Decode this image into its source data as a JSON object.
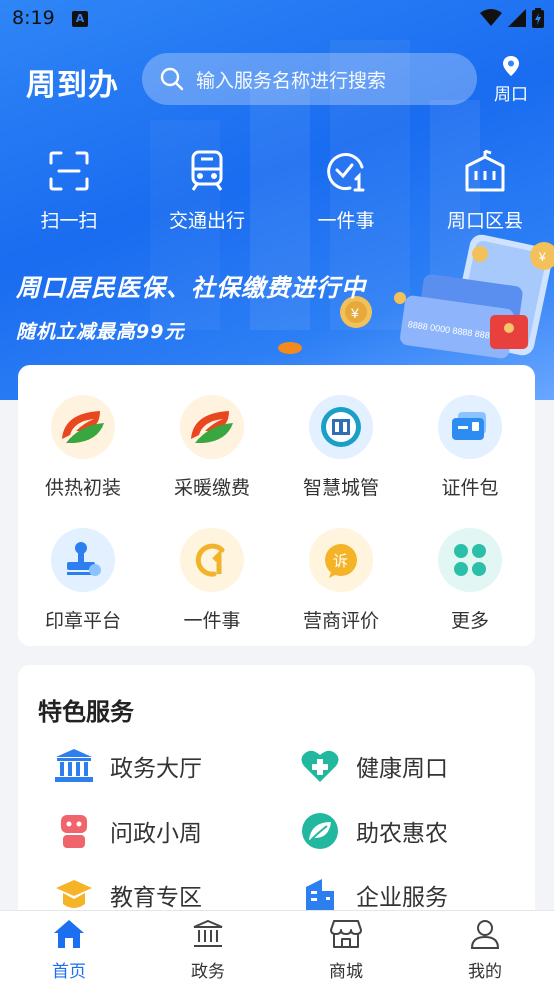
{
  "status_bar": {
    "time": "8:19"
  },
  "header": {
    "app_title": "周到办",
    "search_placeholder": "输入服务名称进行搜索",
    "location": "周口"
  },
  "quick_actions": [
    {
      "label": "扫一扫",
      "icon": "scan-icon"
    },
    {
      "label": "交通出行",
      "icon": "train-icon"
    },
    {
      "label": "一件事",
      "icon": "check-one-icon"
    },
    {
      "label": "周口区县",
      "icon": "building-icon"
    }
  ],
  "banner": {
    "title": "周口居民医保、社保缴费进行中",
    "subtitle": "随机立减最高99元",
    "card_number": "8888 0000 8888 888"
  },
  "service_grid": [
    {
      "label": "供热初装",
      "icon": "leaf-logo-icon"
    },
    {
      "label": "采暖缴费",
      "icon": "leaf-logo-icon"
    },
    {
      "label": "智慧城管",
      "icon": "city-badge-icon"
    },
    {
      "label": "证件包",
      "icon": "id-card-icon"
    },
    {
      "label": "印章平台",
      "icon": "stamp-icon"
    },
    {
      "label": "一件事",
      "icon": "one-thing-icon"
    },
    {
      "label": "营商评价",
      "icon": "complaint-icon"
    },
    {
      "label": "更多",
      "icon": "more-grid-icon"
    }
  ],
  "featured": {
    "title": "特色服务",
    "items": [
      {
        "label": "政务大厅",
        "icon": "hall-icon"
      },
      {
        "label": "健康周口",
        "icon": "health-icon"
      },
      {
        "label": "问政小周",
        "icon": "robot-icon"
      },
      {
        "label": "助农惠农",
        "icon": "farm-leaf-icon"
      },
      {
        "label": "教育专区",
        "icon": "graduation-icon"
      },
      {
        "label": "企业服务",
        "icon": "office-icon"
      }
    ]
  },
  "bottom_nav": [
    {
      "label": "首页",
      "icon": "home-icon",
      "active": true
    },
    {
      "label": "政务",
      "icon": "government-icon",
      "active": false
    },
    {
      "label": "商城",
      "icon": "shop-icon",
      "active": false
    },
    {
      "label": "我的",
      "icon": "profile-icon",
      "active": false
    }
  ],
  "colors": {
    "primary": "#1d6ff2",
    "hero": "#2f86f6",
    "background": "#f2f4f7"
  }
}
